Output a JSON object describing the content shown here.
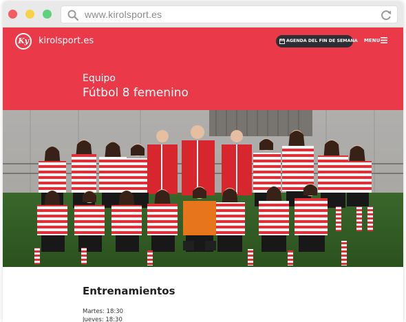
{
  "browser": {
    "url": "www.kirolsport.es",
    "icons": [
      "search-icon",
      "reload-icon"
    ],
    "traffic_light_colors": [
      "#f35d5f",
      "#f5d248",
      "#5dd27a"
    ]
  },
  "navbar": {
    "logo_text": "Ky",
    "brand": "kirolsport.es",
    "agenda_label": "AGENDA DEL FIN DE SEMANA",
    "menu_label": "MENU",
    "accent_color": "#ea3a4a"
  },
  "hero": {
    "subtitle": "Equipo",
    "title": "Fútbol 8 femenino"
  },
  "team_photo": {
    "description_icon": "team-photo"
  },
  "trainings": {
    "title": "Entrenamientos",
    "schedule": [
      "Martes: 18:30",
      "Jueves: 18:30"
    ]
  }
}
